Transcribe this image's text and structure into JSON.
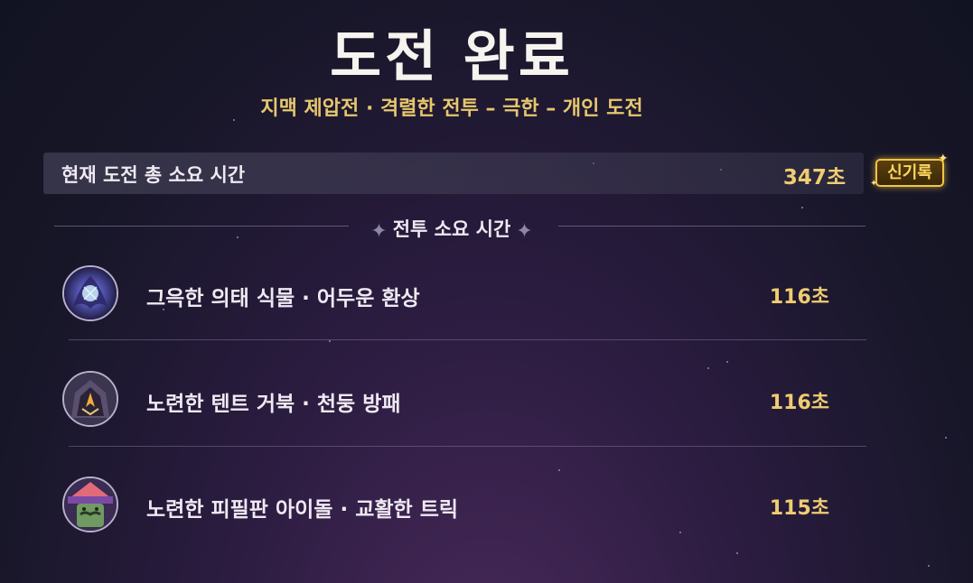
{
  "header": {
    "title": "도전 완료",
    "subtitle": "지맥 제압전 · 격렬한 전투 – 극한 – 개인 도전"
  },
  "total": {
    "label": "현재 도전 총 소요 시간",
    "value": "347초",
    "badge": "신기록"
  },
  "section": {
    "title": "전투 소요 시간"
  },
  "enemies": [
    {
      "name": "그윽한 의태 식물 · 어두운 환상",
      "time": "116초",
      "icon": "dark-plant-icon"
    },
    {
      "name": "노련한 텐트 거북 · 천둥 방패",
      "time": "116초",
      "icon": "tent-turtle-icon"
    },
    {
      "name": "노련한 피필판 아이돌 · 교활한 트릭",
      "time": "115초",
      "icon": "pipilpan-idol-icon"
    }
  ],
  "colors": {
    "accent_gold": "#f0cc72",
    "subtitle_gold": "#e7c76e",
    "badge_gold": "#f4c542",
    "text": "#efe9f2"
  }
}
